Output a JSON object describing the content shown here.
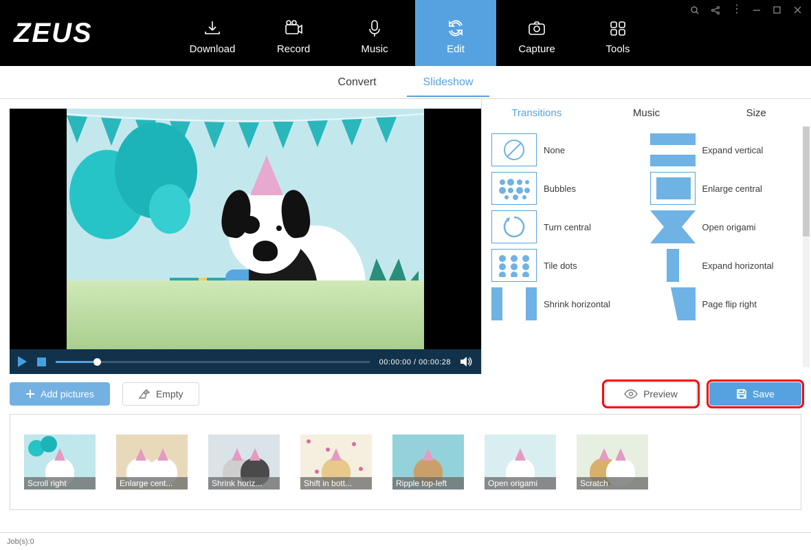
{
  "app": {
    "logo": "ZEUS"
  },
  "nav": {
    "items": [
      {
        "label": "Download"
      },
      {
        "label": "Record"
      },
      {
        "label": "Music"
      },
      {
        "label": "Edit"
      },
      {
        "label": "Capture"
      },
      {
        "label": "Tools"
      }
    ],
    "active_index": 3
  },
  "subtabs": {
    "items": [
      {
        "label": "Convert"
      },
      {
        "label": "Slideshow"
      }
    ],
    "active_index": 1
  },
  "player": {
    "time_current": "00:00:00",
    "time_total": "00:00:28",
    "time_separator": " / "
  },
  "panel": {
    "tabs": [
      {
        "label": "Transitions"
      },
      {
        "label": "Music"
      },
      {
        "label": "Size"
      }
    ],
    "active_index": 0,
    "transitions_left": [
      {
        "label": "None"
      },
      {
        "label": "Bubbles"
      },
      {
        "label": "Turn central"
      },
      {
        "label": "Tile dots"
      },
      {
        "label": "Shrink horizontal"
      }
    ],
    "transitions_right": [
      {
        "label": "Expand vertical"
      },
      {
        "label": "Enlarge central"
      },
      {
        "label": "Open origami"
      },
      {
        "label": "Expand horizontal"
      },
      {
        "label": "Page flip right"
      }
    ]
  },
  "actions": {
    "add_pictures": "Add pictures",
    "empty": "Empty",
    "preview": "Preview",
    "save": "Save"
  },
  "filmstrip": [
    {
      "label": "Scroll right"
    },
    {
      "label": "Enlarge cent..."
    },
    {
      "label": "Shrink horiz..."
    },
    {
      "label": "Shift in bott..."
    },
    {
      "label": "Ripple top-left"
    },
    {
      "label": "Open origami"
    },
    {
      "label": "Scratch"
    }
  ],
  "status": {
    "jobs_label": "Job(s): ",
    "jobs_count": "0"
  },
  "colors": {
    "accent": "#56a2e0",
    "highlight": "#fc0000"
  }
}
